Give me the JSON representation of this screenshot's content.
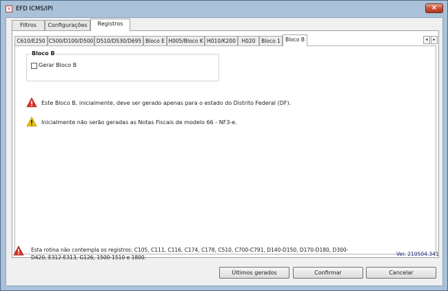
{
  "window": {
    "title": "EFD ICMS/IPI",
    "icon": "app-document-icon",
    "close": "×"
  },
  "outer_tabs": [
    "Filtros",
    "Configurações",
    "Registros"
  ],
  "outer_active": "Registros",
  "inner_tabs": [
    "C610/E250",
    "C500/D100/D500",
    "D510/D530/D695",
    "Bloco E",
    "H005/Bloco K",
    "H010/K200",
    "H020",
    "Bloco 1",
    "Bloco B"
  ],
  "inner_active": "Bloco B",
  "tab_scroll": {
    "left": "◂",
    "right": "▸"
  },
  "bloco_b": {
    "group_title": "Bloco B",
    "checkbox_label": "Gerar Bloco B",
    "checkbox_checked": false
  },
  "messages": [
    {
      "icon": "error-triangle-icon",
      "color": "#d9342b",
      "text": "Este Bloco B, inicialmente, deve ser gerado apenas para o estado do Distrito Federal (DF)."
    },
    {
      "icon": "warning-triangle-icon",
      "color": "#f2c200",
      "text": "Inicialmente não serão geradas as Notas Fiscais de modelo 66 - NF3-e."
    }
  ],
  "footer": {
    "notice": "Esta rotina não contempla os registros: C105, C111, C116, C174, C178, C510, C700-C791, D140-D150, D170-D180, D300-D420, E312-E313, G126, 1500-1510 e 1800.",
    "version": "Ver. 210504.341"
  },
  "buttons": {
    "ultimos": "Últimos gerados",
    "confirmar": "Confirmar",
    "cancelar": "Cancelar"
  }
}
